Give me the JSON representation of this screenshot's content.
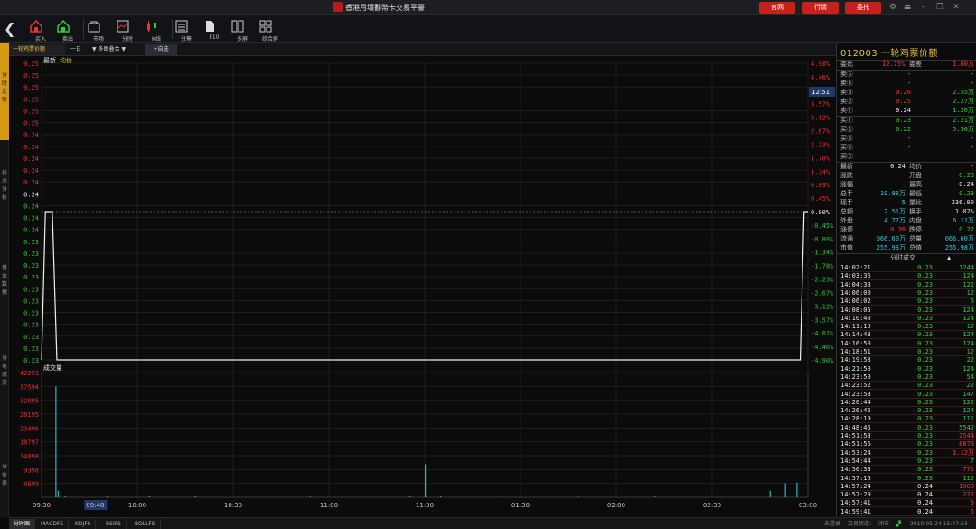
{
  "window": {
    "title": "香港月壤鄱幣卡交易平臺",
    "buttons": [
      "官网",
      "行情",
      "委托"
    ],
    "icons": [
      "settings-icon",
      "eject-icon",
      "minimize-icon",
      "restore-icon",
      "close-icon"
    ]
  },
  "toolbar": {
    "items": [
      {
        "label": "买入",
        "icon": "buy-icon"
      },
      {
        "label": "卖出",
        "icon": "sell-icon"
      },
      {
        "label": "市场",
        "icon": "market-icon"
      },
      {
        "label": "分时",
        "icon": "timeshare-icon"
      },
      {
        "label": "K线",
        "icon": "kline-icon"
      },
      {
        "label": "分筹",
        "icon": "chip-icon"
      },
      {
        "label": "F10",
        "icon": "f10-icon"
      },
      {
        "label": "多屏",
        "icon": "multiscreen-icon"
      },
      {
        "label": "综合屏",
        "icon": "combined-screen-icon"
      }
    ]
  },
  "left_tabs": [
    "分时走势",
    "技术分析",
    "基本数据",
    "分笔成交",
    "分价表"
  ],
  "chart_tabs": {
    "product": "一轮鸡票价额",
    "period": "一日",
    "mode": "多图叠合",
    "add": "+自选"
  },
  "legend": {
    "last": "最新",
    "avg": "均价"
  },
  "volume_label": "成交量",
  "current_label": "12.51",
  "chart_data": [
    {
      "type": "line",
      "y_left_ticks": [
        "0.25",
        "0.25",
        "0.25",
        "0.25",
        "0.25",
        "0.25",
        "0.24",
        "0.24",
        "0.24",
        "0.24",
        "0.24",
        "0.24",
        "0.24",
        "0.24",
        "0.24",
        "0.23",
        "0.23",
        "0.23",
        "0.23",
        "0.23",
        "0.23",
        "0.23",
        "0.23",
        "0.23",
        "0.23",
        "0.23"
      ],
      "y_right_ticks": [
        "4.90%",
        "4.46%",
        "4.01%",
        "3.57%",
        "3.12%",
        "2.67%",
        "2.23%",
        "1.78%",
        "1.34%",
        "0.89%",
        "0.45%",
        "0.00%",
        "-0.45%",
        "-0.89%",
        "-1.34%",
        "-1.78%",
        "-2.23%",
        "-2.67%",
        "-3.12%",
        "-3.57%",
        "-4.01%",
        "-4.46%",
        "-4.90%"
      ],
      "x_ticks": [
        "09:30",
        "09:48",
        "10:00",
        "10:30",
        "11:00",
        "11:30",
        "01:30",
        "02:00",
        "02:30",
        "03:00"
      ],
      "ylim": [
        0.2282,
        0.2518
      ],
      "series": [
        {
          "values": [
            [
              0.0,
              0.2282
            ],
            [
              0.005,
              0.24
            ],
            [
              0.014,
              0.24
            ],
            [
              0.02,
              0.2282
            ],
            [
              0.99,
              0.2282
            ],
            [
              0.995,
              0.24
            ],
            [
              1.0,
              0.24
            ]
          ]
        }
      ]
    },
    {
      "type": "bar",
      "title": "成交量",
      "y_ticks": [
        "42293",
        "37594",
        "32895",
        "28195",
        "23496",
        "18797",
        "14098",
        "9398",
        "4699"
      ],
      "ylim": [
        0,
        42293
      ],
      "bars": [
        [
          0.018,
          37600
        ],
        [
          0.021,
          2200
        ],
        [
          0.03,
          500
        ],
        [
          0.085,
          400
        ],
        [
          0.14,
          300
        ],
        [
          0.2,
          300
        ],
        [
          0.35,
          250
        ],
        [
          0.48,
          400
        ],
        [
          0.5,
          11200
        ],
        [
          0.52,
          300
        ],
        [
          0.6,
          250
        ],
        [
          0.7,
          200
        ],
        [
          0.8,
          250
        ],
        [
          0.95,
          2200
        ],
        [
          0.97,
          4800
        ],
        [
          0.985,
          4900
        ]
      ]
    }
  ],
  "quote": {
    "title": "012003 一轮鸡票价额",
    "ratio": {
      "label1": "委比",
      "val1": "12.75%",
      "label2": "委差",
      "val2": "1.60万"
    },
    "sells": [
      {
        "label": "卖⑤",
        "price": "-",
        "vol": "-"
      },
      {
        "label": "卖④",
        "price": "-",
        "vol": "-"
      },
      {
        "label": "卖③",
        "price": "0.26",
        "vol": "2.55万"
      },
      {
        "label": "卖②",
        "price": "0.25",
        "vol": "2.27万"
      },
      {
        "label": "卖①",
        "price": "0.24",
        "vol": "1.20万"
      }
    ],
    "buys": [
      {
        "label": "买①",
        "price": "0.23",
        "vol": "2.21万"
      },
      {
        "label": "买②",
        "price": "0.22",
        "vol": "5.50万"
      },
      {
        "label": "买③",
        "price": "-",
        "vol": "-"
      },
      {
        "label": "买④",
        "price": "-",
        "vol": "-"
      },
      {
        "label": "买⑤",
        "price": "-",
        "vol": "-"
      }
    ],
    "stats": [
      {
        "l1": "最新",
        "v1": "0.24",
        "l2": "均价",
        "v2": "-"
      },
      {
        "l1": "涨跌",
        "v1": "-",
        "l2": "开盘",
        "v2": "0.23"
      },
      {
        "l1": "涨幅",
        "v1": "-",
        "l2": "最高",
        "v2": "0.24"
      },
      {
        "l1": "总手",
        "v1": "10.88万",
        "l2": "最低",
        "v2": "0.23"
      },
      {
        "l1": "现手",
        "v1": "5",
        "l2": "量比",
        "v2": "236.00"
      },
      {
        "l1": "总额",
        "v1": "2.51万",
        "l2": "换手",
        "v2": "1.02%"
      },
      {
        "l1": "外盘",
        "v1": "4.77万",
        "l2": "内盘",
        "v2": "6.11万"
      },
      {
        "l1": "涨停",
        "v1": "0.26",
        "l2": "跌停",
        "v2": "0.22"
      },
      {
        "l1": "流通",
        "v1": "066.60万",
        "l2": "总量",
        "v2": "066.60万"
      },
      {
        "l1": "市值",
        "v1": "255.98万",
        "l2": "总值",
        "v2": "255.98万"
      }
    ],
    "ticks_header": "分时成交",
    "ticks": [
      [
        "14:02:21",
        "0.23",
        "1244"
      ],
      [
        "14:03:36",
        "0.23",
        "124"
      ],
      [
        "14:04:38",
        "0.23",
        "121"
      ],
      [
        "14:06:00",
        "0.23",
        "12"
      ],
      [
        "14:06:02",
        "0.23",
        "5"
      ],
      [
        "14:08:05",
        "0.23",
        "124"
      ],
      [
        "14:10:40",
        "0.23",
        "124"
      ],
      [
        "14:11:10",
        "0.23",
        "12"
      ],
      [
        "14:14:43",
        "0.23",
        "124"
      ],
      [
        "14:16:50",
        "0.23",
        "124"
      ],
      [
        "14:18:51",
        "0.23",
        "12"
      ],
      [
        "14:19:53",
        "0.23",
        "22"
      ],
      [
        "14:21:50",
        "0.23",
        "124"
      ],
      [
        "14:23:50",
        "0.23",
        "54"
      ],
      [
        "14:23:52",
        "0.23",
        "22"
      ],
      [
        "14:23:53",
        "0.23",
        "147"
      ],
      [
        "14:26:44",
        "0.23",
        "122"
      ],
      [
        "14:26:46",
        "0.23",
        "124"
      ],
      [
        "14:28:19",
        "0.23",
        "111"
      ],
      [
        "14:48:45",
        "0.23",
        "5542"
      ],
      [
        "14:51:53",
        "0.23",
        "2544"
      ],
      [
        "14:51:56",
        "0.23",
        "8878"
      ],
      [
        "14:53:24",
        "0.23",
        "1.12万"
      ],
      [
        "14:54:44",
        "0.23",
        "7"
      ],
      [
        "14:56:33",
        "0.23",
        "771"
      ],
      [
        "14:57:16",
        "0.23",
        "112"
      ],
      [
        "14:57:24",
        "0.24",
        "1000"
      ],
      [
        "14:57:29",
        "0.24",
        "222"
      ],
      [
        "14:57:41",
        "0.24",
        "5"
      ],
      [
        "14:59:41",
        "0.24",
        "5"
      ]
    ]
  },
  "bottom": {
    "tabs": [
      "分时图",
      "MACDFS",
      "KDJFS",
      "RSIFS",
      "BOLLFS"
    ],
    "status1": "未登录",
    "status2": "交易状态：",
    "status3": "闭市",
    "datetime": "2019-05-24 15:47:53"
  }
}
